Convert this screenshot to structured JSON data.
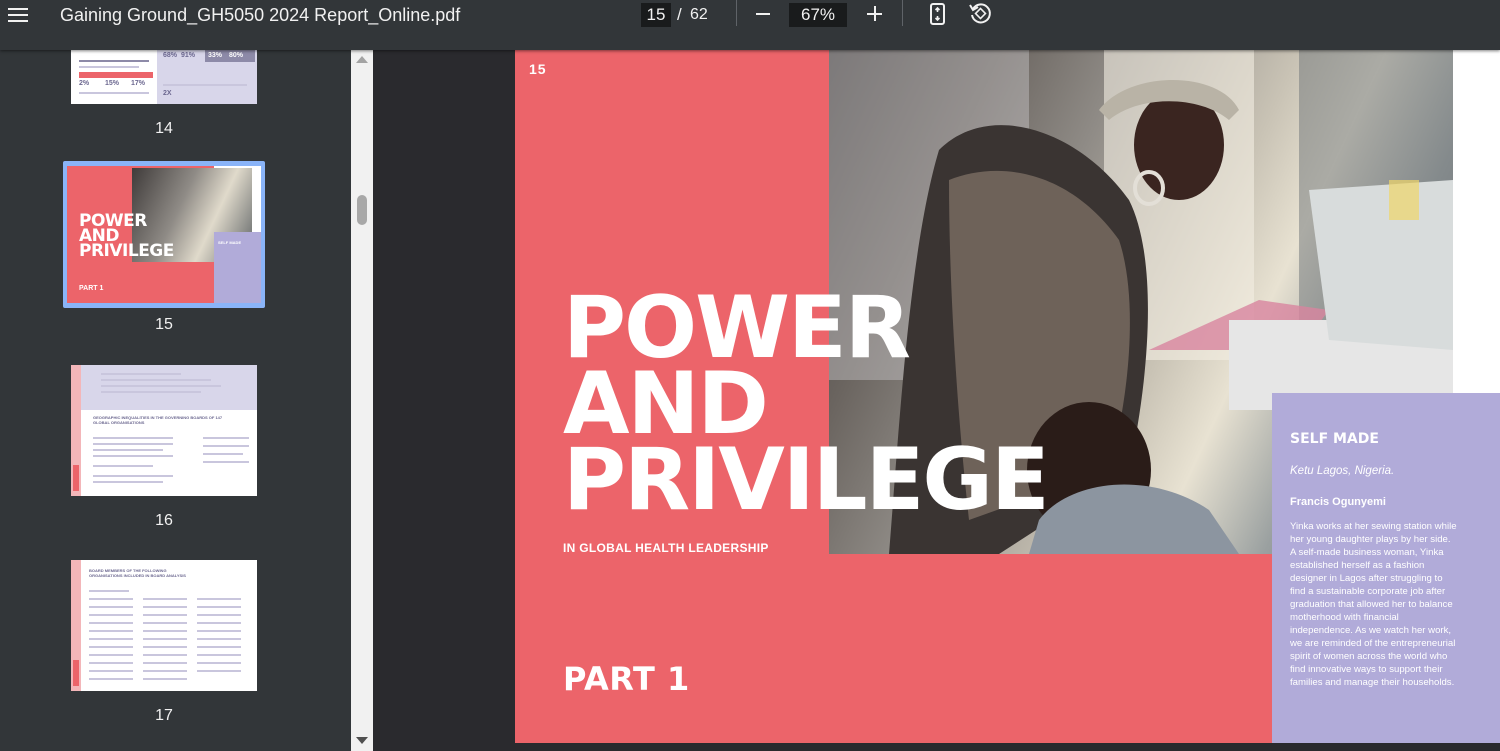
{
  "toolbar": {
    "title": "Gaining Ground_GH5050 2024 Report_Online.pdf",
    "current_page": "15",
    "page_separator": "/",
    "total_pages": "62",
    "zoom": "67%"
  },
  "sidebar": {
    "thumbnails": [
      {
        "page": "14",
        "stats": [
          "68%",
          "91%",
          "33%",
          "80%",
          "2%",
          "15%",
          "17%",
          "2X"
        ]
      },
      {
        "page": "15",
        "title_lines": [
          "POWER",
          "AND",
          "PRIVILEGE"
        ],
        "part": "PART 1",
        "side_title": "SELF MADE"
      },
      {
        "page": "16",
        "heading": "GEOGRAPHIC INEQUALITIES IN THE GOVERNING BOARDS OF 147 GLOBAL ORGANISATIONS"
      },
      {
        "page": "17",
        "heading": "BOARD MEMBERS OF THE FOLLOWING ORGANISATIONS INCLUDED IN BOARD ANALYSIS"
      }
    ]
  },
  "page": {
    "number": "15",
    "title_lines": [
      "POWER",
      "AND",
      "PRIVILEGE"
    ],
    "subtitle": "IN GLOBAL HEALTH LEADERSHIP",
    "part": "PART 1",
    "side": {
      "title": "SELF MADE",
      "location": "Ketu Lagos, Nigeria.",
      "name": "Francis Ogunyemi",
      "body": "Yinka works at her sewing station while her young daughter plays by her side. A self-made business woman, Yinka established herself as a fashion designer in Lagos after struggling to find a sustainable corporate job after graduation that allowed her to balance motherhood with financial independence. As we watch her work, we are reminded of the entrepreneurial spirit of women across the world who find innovative ways to support their families and manage their households."
    },
    "photo": "woman-sewing-with-daughter-photo"
  },
  "colors": {
    "toolbar": "#323639",
    "viewer_bg": "#2a2a2e",
    "page_red": "#ec646a",
    "side_lavender": "#b1abd9",
    "selected_thumb": "#8ab4f8"
  }
}
